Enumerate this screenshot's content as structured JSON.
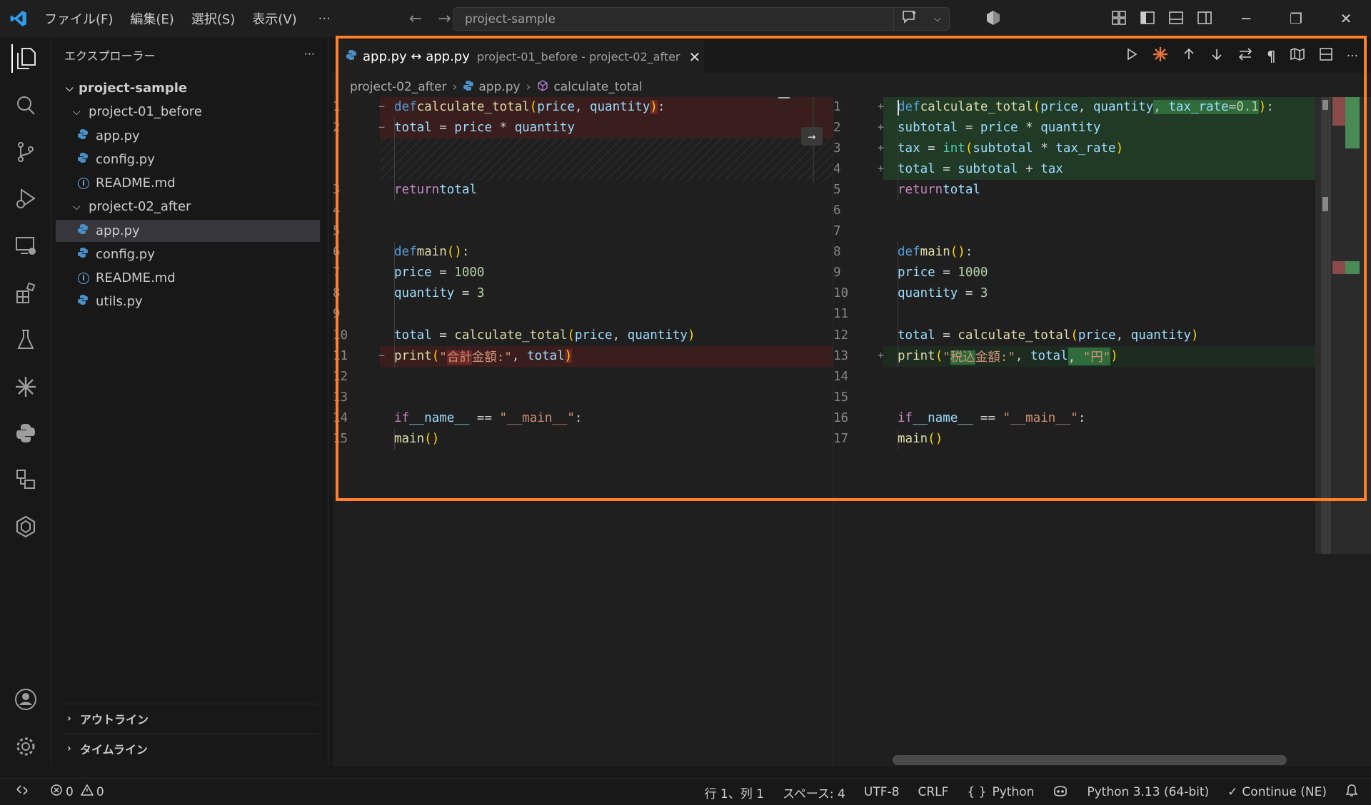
{
  "titlebar": {
    "menus": [
      "ファイル(F)",
      "編集(E)",
      "選択(S)",
      "表示(V)"
    ],
    "more": "···",
    "search_text": "project-sample"
  },
  "explorer": {
    "title": "エクスプローラー",
    "more": "···",
    "root": "project-sample",
    "folders": [
      {
        "name": "project-01_before",
        "files": [
          "app.py",
          "config.py",
          "README.md"
        ]
      },
      {
        "name": "project-02_after",
        "files": [
          "app.py",
          "config.py",
          "README.md",
          "utils.py"
        ]
      }
    ],
    "outline": "アウトライン",
    "timeline": "タイムライン"
  },
  "tab": {
    "name": "app.py ↔ app.py",
    "description": "project-01_before - project-02_after"
  },
  "breadcrumb": [
    "project-02_after",
    "app.py",
    "calculate_total"
  ],
  "left_lines": [
    "1",
    "2",
    "3",
    "4",
    "5",
    "6",
    "7",
    "8",
    "9",
    "10",
    "11",
    "12",
    "13",
    "14",
    "15"
  ],
  "right_lines": [
    "1",
    "2",
    "3",
    "4",
    "5",
    "6",
    "7",
    "8",
    "9",
    "10",
    "11",
    "12",
    "13",
    "14",
    "15",
    "16",
    "17"
  ],
  "status": {
    "errors": "0",
    "warnings": "0",
    "position": "行 1、列 1",
    "spaces": "スペース: 4",
    "encoding": "UTF-8",
    "eol": "CRLF",
    "language": "Python",
    "interpreter": "Python 3.13 (64-bit)",
    "continue": "Continue (NE)"
  },
  "colors": {
    "accent_highlight": "#ff7f27",
    "deleted_line": "#3a1e1e",
    "inserted_line": "#213a26"
  }
}
